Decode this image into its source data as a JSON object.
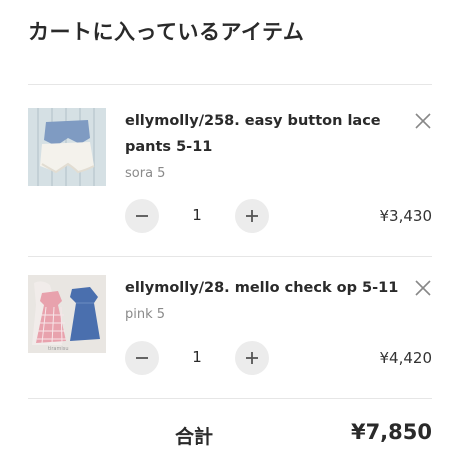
{
  "cart": {
    "title": "カートに入っているアイテム",
    "items": [
      {
        "name": "ellymolly/258. easy button lace pants 5-11",
        "variant": "sora 5",
        "quantity": "1",
        "price": "¥3,430",
        "image": "blue and white lace shorts product photo"
      },
      {
        "name": "ellymolly/28. mello check op 5-11",
        "variant": "pink 5",
        "quantity": "1",
        "price": "¥4,420",
        "image": "pink check dress and blue dress product photo"
      }
    ],
    "total_label": "合計",
    "total_value": "¥7,850"
  },
  "icons": {
    "remove": "close-icon",
    "decrement": "minus-icon",
    "increment": "plus-icon"
  },
  "colors": {
    "button_bg": "#ececec",
    "divider": "#e6e6e6",
    "variant_text": "#8a8a8a"
  }
}
